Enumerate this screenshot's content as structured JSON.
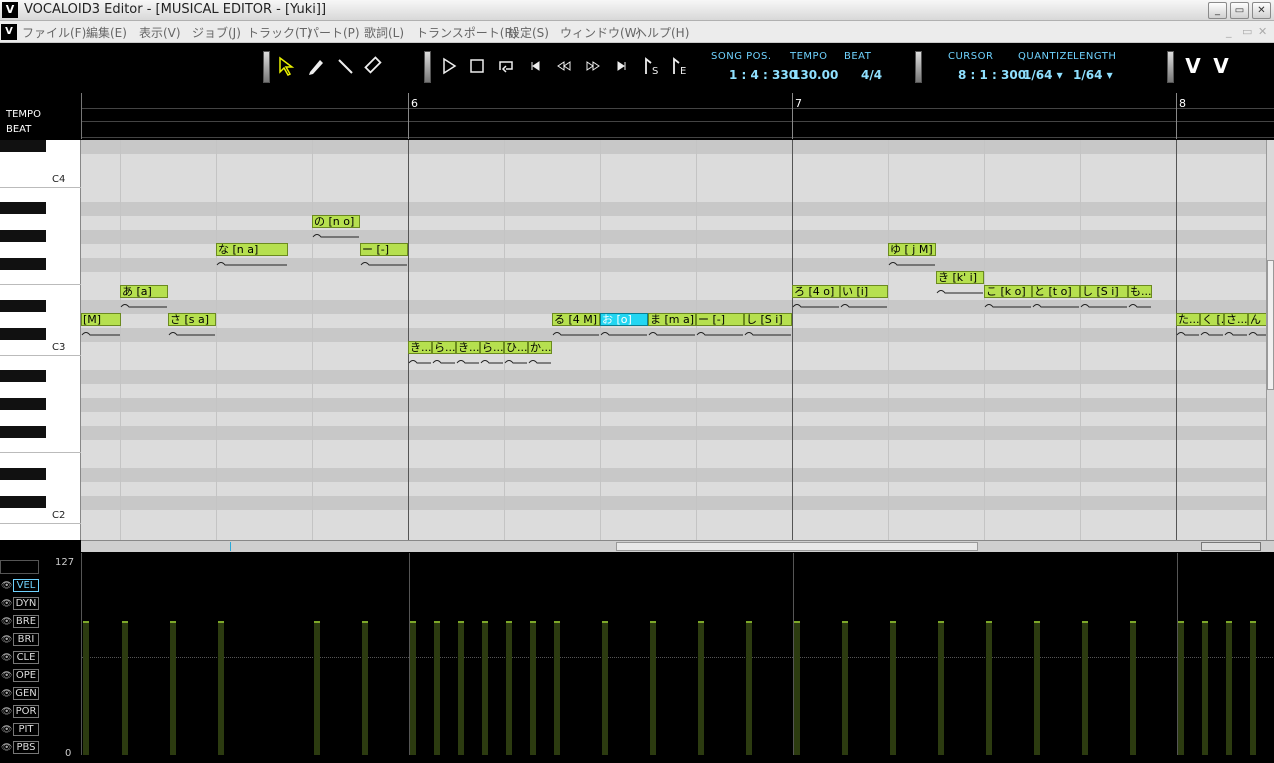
{
  "window": {
    "title": "VOCALOID3 Editor - [MUSICAL EDITOR - [Yuki]]",
    "app_icon": "V",
    "minimize": "_",
    "maximize": "▭",
    "close": "✕"
  },
  "menu": {
    "items": [
      "ファイル(F)",
      "編集(E)",
      "表示(V)",
      "ジョブ(J)",
      "トラック(T)",
      "パート(P)",
      "歌詞(L)",
      "トランスポート(R)",
      "設定(S)",
      "ウィンドウ(W)",
      "ヘルプ(H)"
    ]
  },
  "toolbar": {
    "song_pos_label": "SONG POS.",
    "song_pos_value": "1 : 4 : 330",
    "tempo_label": "TEMPO",
    "tempo_value": "130.00",
    "beat_label": "BEAT",
    "beat_value": "4/4",
    "cursor_label": "CURSOR",
    "cursor_value": "8 : 1 : 300",
    "quantize_label": "QUANTIZE",
    "quantize_value": "1/64 ▾",
    "length_label": "LENGTH",
    "length_value": "1/64 ▾",
    "start_marker": "S",
    "end_marker": "E"
  },
  "ruler": {
    "tempo_label": "TEMPO",
    "beat_label": "BEAT",
    "measures": [
      "6",
      "7",
      "8"
    ]
  },
  "piano": {
    "octaves": [
      "C4",
      "C3",
      "C2"
    ]
  },
  "notes": [
    {
      "lyric": "[M]",
      "selected": false
    },
    {
      "lyric": "あ [a]",
      "selected": false
    },
    {
      "lyric": "さ [s a]",
      "selected": false
    },
    {
      "lyric": "な [n a]",
      "selected": false
    },
    {
      "lyric": "の [n o]",
      "selected": false
    },
    {
      "lyric": "ー [-]",
      "selected": false
    },
    {
      "lyric": "き...",
      "selected": false
    },
    {
      "lyric": "ら...",
      "selected": false
    },
    {
      "lyric": "き...",
      "selected": false
    },
    {
      "lyric": "ら...",
      "selected": false
    },
    {
      "lyric": "ひ...",
      "selected": false
    },
    {
      "lyric": "か...",
      "selected": false
    },
    {
      "lyric": "る [4 M]",
      "selected": false
    },
    {
      "lyric": "お [o]",
      "selected": true
    },
    {
      "lyric": "ま [m a]",
      "selected": false
    },
    {
      "lyric": "ー [-]",
      "selected": false
    },
    {
      "lyric": "し [S i]",
      "selected": false
    },
    {
      "lyric": "ろ [4 o]",
      "selected": false
    },
    {
      "lyric": "い [i]",
      "selected": false
    },
    {
      "lyric": "ゆ [ j M]",
      "selected": false
    },
    {
      "lyric": "き [k' i]",
      "selected": false
    },
    {
      "lyric": "こ [k o]",
      "selected": false
    },
    {
      "lyric": "と [t o]",
      "selected": false
    },
    {
      "lyric": "し [S i]",
      "selected": false
    },
    {
      "lyric": "も...",
      "selected": false
    },
    {
      "lyric": "た...",
      "selected": false
    },
    {
      "lyric": "く [...",
      "selected": false
    },
    {
      "lyric": "さ...",
      "selected": false
    },
    {
      "lyric": "ん",
      "selected": false
    }
  ],
  "control": {
    "max": "127",
    "min": "0",
    "tracks": [
      "VEL",
      "DYN",
      "BRE",
      "BRI",
      "CLE",
      "OPE",
      "GEN",
      "POR",
      "PIT",
      "PBS"
    ],
    "active_track": "VEL"
  }
}
